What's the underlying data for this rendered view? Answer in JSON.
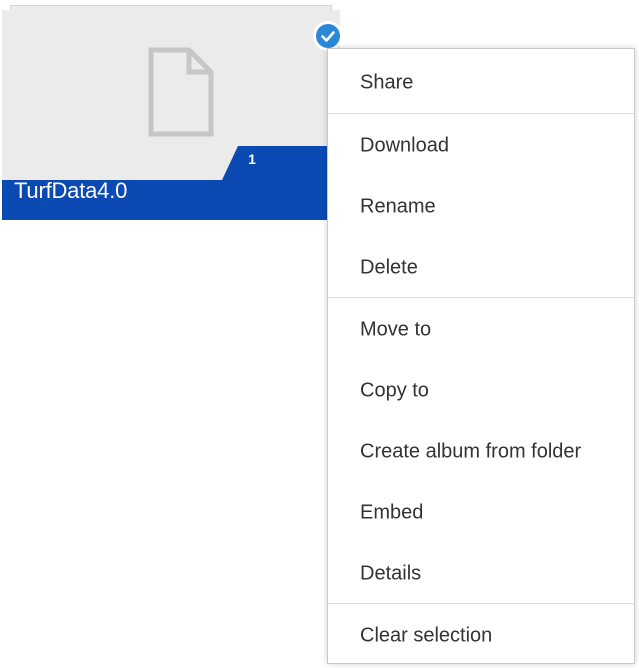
{
  "folder": {
    "name": "TurfData4.0",
    "item_count": "1",
    "selected": true,
    "icon": "file-icon",
    "selection_icon": "checkmark-circle-icon",
    "accent_color": "#0b4ab3",
    "badge_color": "#2b88d8"
  },
  "context_menu": {
    "items": [
      {
        "label": "Share"
      },
      {
        "label": "Download"
      },
      {
        "label": "Rename"
      },
      {
        "label": "Delete"
      },
      {
        "label": "Move to"
      },
      {
        "label": "Copy to"
      },
      {
        "label": "Create album from folder"
      },
      {
        "label": "Embed"
      },
      {
        "label": "Details"
      },
      {
        "label": "Clear selection"
      }
    ]
  }
}
